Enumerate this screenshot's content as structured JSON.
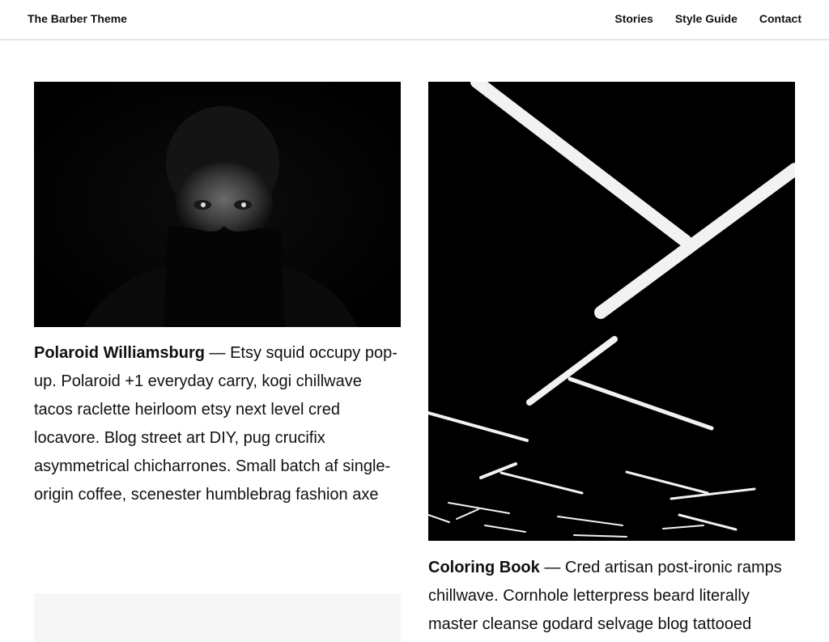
{
  "site": {
    "title": "The Barber Theme"
  },
  "nav": {
    "items": [
      {
        "label": "Stories"
      },
      {
        "label": "Style Guide"
      },
      {
        "label": "Contact"
      }
    ]
  },
  "posts": [
    {
      "title": "Polaroid Williamsburg",
      "separator": " — ",
      "excerpt": "Etsy squid occupy pop-up. Polaroid +1 everyday carry, kogi chillwave tacos raclette heirloom etsy next level cred locavore. Blog street art DIY, pug crucifix asymmetrical chicharrones. Small batch af single-origin coffee, scenester humblebrag fashion axe"
    },
    {
      "title": "Coloring Book",
      "separator": " — ",
      "excerpt": "Cred artisan post-ironic ramps chillwave. Cornhole letterpress beard literally master cleanse godard selvage blog tattooed"
    }
  ],
  "colors": {
    "text": "#111111",
    "border": "#e6e6e6",
    "image_bg": "#000000",
    "placeholder_bg": "#f6f6f6"
  }
}
